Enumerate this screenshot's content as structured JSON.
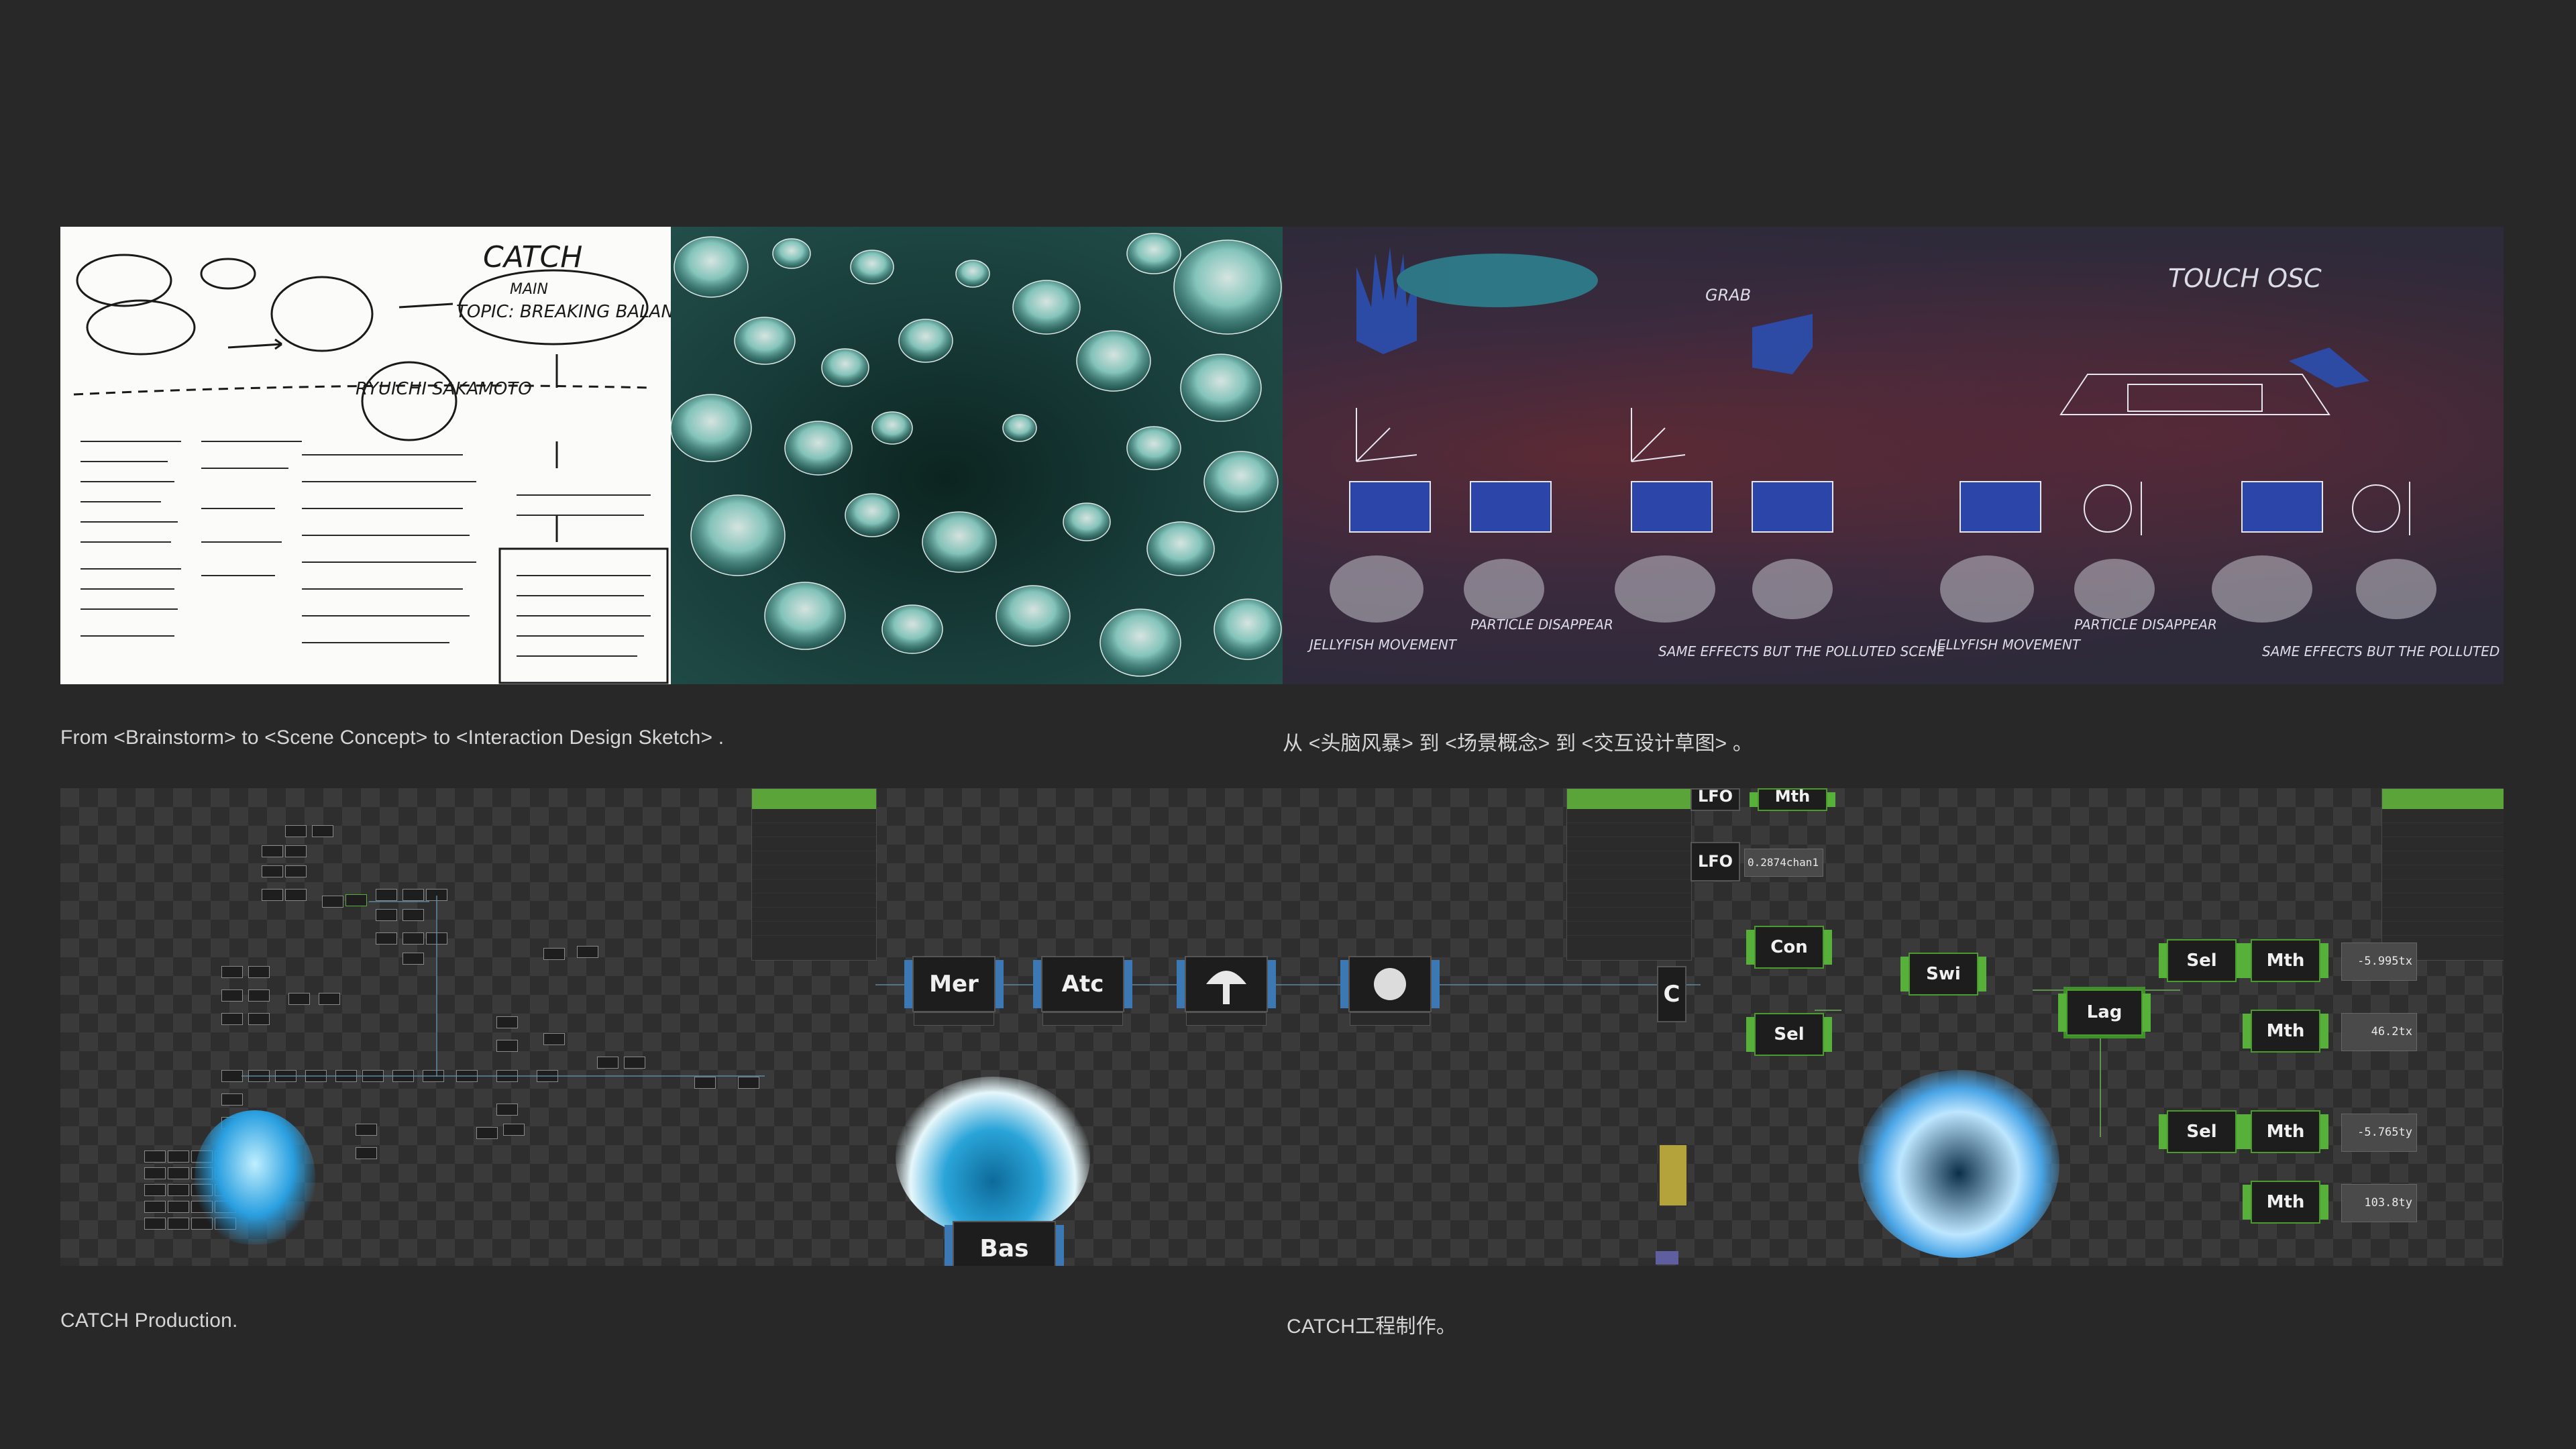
{
  "gallery": {
    "sketch_title": "CATCH",
    "sketch_topic": "TOPIC: BREAKING BALANCE",
    "sketch_main": "MAIN",
    "sketch_artist": "RYUICHI SAKAMOTO",
    "idsketch_title": "TOUCH OSC",
    "idsketch_grab": "GRAB",
    "idsketch_label_jelly_1": "JELLYFISH MOVEMENT",
    "idsketch_label_particle_1": "PARTICLE DISAPPEAR",
    "idsketch_label_jelly_2": "JELLYFISH MOVEMENT",
    "idsketch_label_particle_2": "PARTICLE DISAPPEAR",
    "idsketch_label_same_1": "SAME EFFECTS BUT THE POLLUTED SCENE",
    "idsketch_label_same_2": "SAME EFFECTS BUT THE POLLUTED SCENE"
  },
  "captions": {
    "process_en": "From <Brainstorm> to <Scene Concept> to <Interaction Design Sketch> .",
    "process_zh": "从 <头脑风暴> 到 <场景概念> 到 <交互设计草图> 。",
    "production_en": "CATCH Production.",
    "production_zh": "CATCH工程制作。"
  },
  "editor": {
    "nodes": {
      "mer": "Mer",
      "atc": "Atc",
      "bas": "Bas",
      "lfo1": "LFO",
      "lfo2": "LFO",
      "mth_top": "Mth",
      "con": "Con",
      "sel1": "Sel",
      "swi": "Swi",
      "lag": "Lag",
      "sel2": "Sel",
      "sel3": "Sel",
      "mth1": "Mth",
      "mth2": "Mth",
      "mth3": "Mth",
      "mth4": "Mth",
      "c_partial": "C"
    },
    "values": {
      "chan": "0.2874chan1",
      "tx1": "-5.995tx",
      "tx2": "46.2tx",
      "ty1": "-5.765ty",
      "ty2": "103.8ty"
    }
  }
}
